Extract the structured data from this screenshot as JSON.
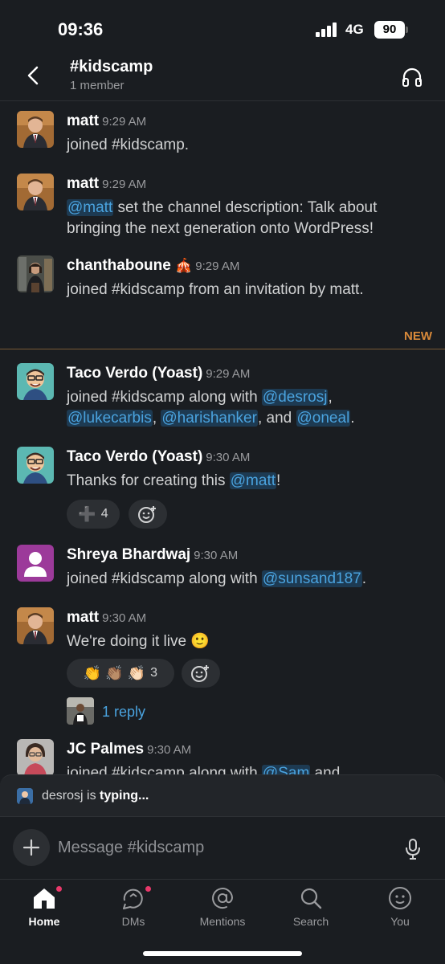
{
  "status": {
    "time": "09:36",
    "network": "4G",
    "battery": "90"
  },
  "header": {
    "title": "#kidscamp",
    "subtitle": "1 member"
  },
  "divider": {
    "label": "NEW"
  },
  "messages": [
    {
      "author": "matt",
      "time": "9:29 AM",
      "lines": [
        {
          "text": "joined #kidscamp."
        }
      ]
    },
    {
      "author": "matt",
      "time": "9:29 AM",
      "mention": "@matt",
      "text_after": " set the channel description: Talk about bringing the next generation onto WordPress!"
    },
    {
      "author": "chanthaboune",
      "badge": "🎪",
      "time": "9:29 AM",
      "text": "joined #kidscamp from an invitation by matt."
    },
    {
      "author": "Taco Verdo (Yoast)",
      "time": "9:29 AM",
      "text_before": "joined #kidscamp along with ",
      "mentions": [
        "@desrosj",
        "@lukecarbis",
        "@harishanker",
        "@oneal"
      ],
      "sep1": ",",
      "sep2": ", ",
      "sep3": ", and ",
      "end": "."
    },
    {
      "author": "Taco Verdo (Yoast)",
      "time": "9:30 AM",
      "text_before": "Thanks for creating this ",
      "mention": "@matt",
      "end": "!",
      "reaction_emoji": "➕",
      "reaction_count": "4"
    },
    {
      "author": "Shreya Bhardwaj",
      "time": "9:30 AM",
      "text_before": "joined #kidscamp along with ",
      "mention": "@sunsand187",
      "end": "."
    },
    {
      "author": "matt",
      "time": "9:30 AM",
      "text": "We're doing it live 🙂",
      "reaction_emojis": "👏 👏🏽 👏🏻",
      "reaction_count": "3",
      "reply_text": "1 reply"
    },
    {
      "author": "JC Palmes",
      "time": "9:30 AM",
      "text_before": "joined #kidscamp along with ",
      "mention": "@Sam",
      "end": " and"
    }
  ],
  "typing": {
    "user": "desrosj",
    "middle": " is ",
    "status": "typing..."
  },
  "composer": {
    "placeholder": "Message #kidscamp"
  },
  "tabs": [
    {
      "label": "Home",
      "icon": "home-icon"
    },
    {
      "label": "DMs",
      "icon": "dms-icon"
    },
    {
      "label": "Mentions",
      "icon": "at-icon"
    },
    {
      "label": "Search",
      "icon": "search-icon"
    },
    {
      "label": "You",
      "icon": "you-icon"
    }
  ],
  "colors": {
    "background": "#1a1d21",
    "mention": "#4aa3df",
    "new_divider": "#d8893a",
    "badge": "#e8386a"
  }
}
